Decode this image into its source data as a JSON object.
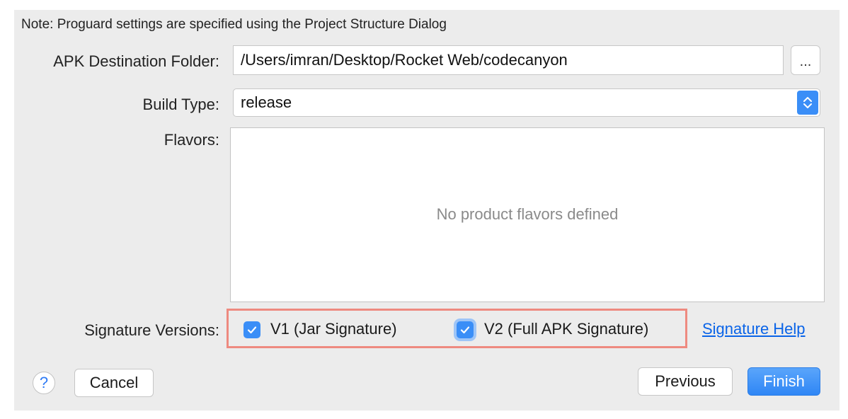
{
  "note": "Note: Proguard settings are specified using the Project Structure Dialog",
  "apk_destination": {
    "label": "APK Destination Folder:",
    "value": "/Users/imran/Desktop/Rocket Web/codecanyon",
    "browse_label": "..."
  },
  "build_type": {
    "label": "Build Type:",
    "value": "release"
  },
  "flavors": {
    "label": "Flavors:",
    "empty_text": "No product flavors defined"
  },
  "signature": {
    "label": "Signature Versions:",
    "v1_label": "V1 (Jar Signature)",
    "v1_checked": true,
    "v2_label": "V2 (Full APK Signature)",
    "v2_checked": true,
    "help_link": "Signature Help",
    "highlight_color": "#ee8a80"
  },
  "buttons": {
    "help": "?",
    "cancel": "Cancel",
    "previous": "Previous",
    "finish": "Finish"
  },
  "colors": {
    "accent": "#3a8ef7",
    "link": "#0a64e8"
  }
}
